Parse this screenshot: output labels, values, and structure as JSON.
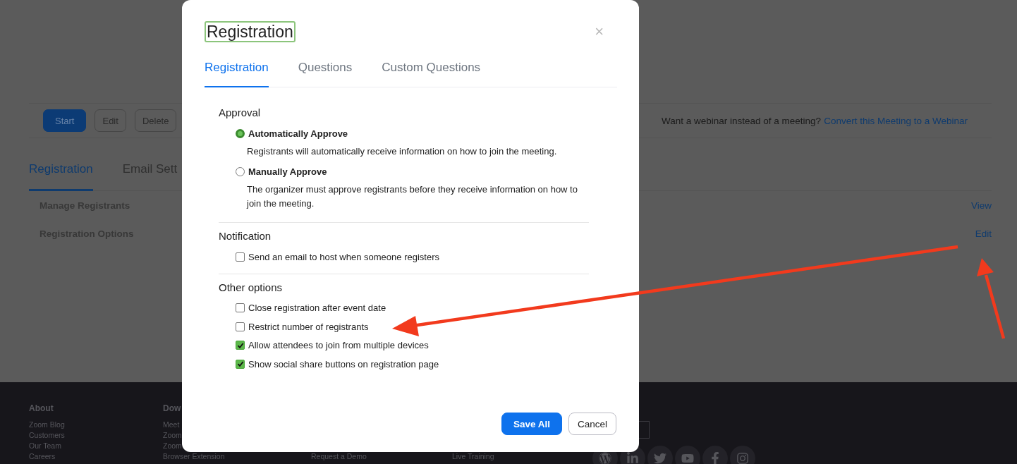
{
  "page": {
    "toolbar": {
      "buttons": [
        {
          "label": "Start",
          "kind": "primary"
        },
        {
          "label": "Edit",
          "kind": "secondary"
        },
        {
          "label": "Delete",
          "kind": "secondary"
        }
      ],
      "webinar_prompt": "Want a webinar instead of a meeting?",
      "webinar_link": "Convert this Meeting to a Webinar"
    },
    "tabs": [
      {
        "label": "Registration",
        "selected": true
      },
      {
        "label": "Email Sett",
        "selected": false
      }
    ],
    "rows": [
      {
        "label": "Manage Registrants",
        "action": "View"
      },
      {
        "label": "Registration Options",
        "action": "Edit"
      }
    ]
  },
  "footer": {
    "columns": [
      {
        "heading": "About",
        "links": [
          "Zoom Blog",
          "Customers",
          "Our Team",
          "Careers"
        ]
      },
      {
        "heading": "Dow",
        "links": [
          "Meet",
          "Zoom",
          "Zoom",
          "Browser Extension"
        ]
      },
      {
        "links": [
          "Request a Demo"
        ]
      },
      {
        "links": [
          "Live Training"
        ]
      }
    ]
  },
  "dialog": {
    "title": "Registration",
    "close": "×",
    "tabs": [
      {
        "label": "Registration",
        "selected": true
      },
      {
        "label": "Questions",
        "selected": false
      },
      {
        "label": "Custom Questions",
        "selected": false
      }
    ],
    "sections": [
      {
        "heading": "Approval",
        "options": [
          {
            "kind": "radio",
            "label": "Automatically Approve",
            "selected": true,
            "description": "Registrants will automatically receive information on how to join the meeting."
          },
          {
            "kind": "radio",
            "label": "Manually Approve",
            "selected": false,
            "description": "The organizer must approve registrants before they receive information on how to join the meeting."
          }
        ]
      },
      {
        "heading": "Notification",
        "options": [
          {
            "kind": "checkbox",
            "label": "Send an email to host when someone registers",
            "checked": false
          }
        ]
      },
      {
        "heading": "Other options",
        "options": [
          {
            "kind": "checkbox",
            "label": "Close registration after event date",
            "checked": false
          },
          {
            "kind": "checkbox",
            "label": "Restrict number of registrants",
            "checked": false
          },
          {
            "kind": "checkbox",
            "label": "Allow attendees to join from multiple devices",
            "checked": true
          },
          {
            "kind": "checkbox",
            "label": "Show social share buttons on registration page",
            "checked": true
          }
        ]
      }
    ],
    "buttons": [
      {
        "label": "Save All",
        "kind": "primary"
      },
      {
        "label": "Cancel",
        "kind": "secondary"
      }
    ]
  }
}
